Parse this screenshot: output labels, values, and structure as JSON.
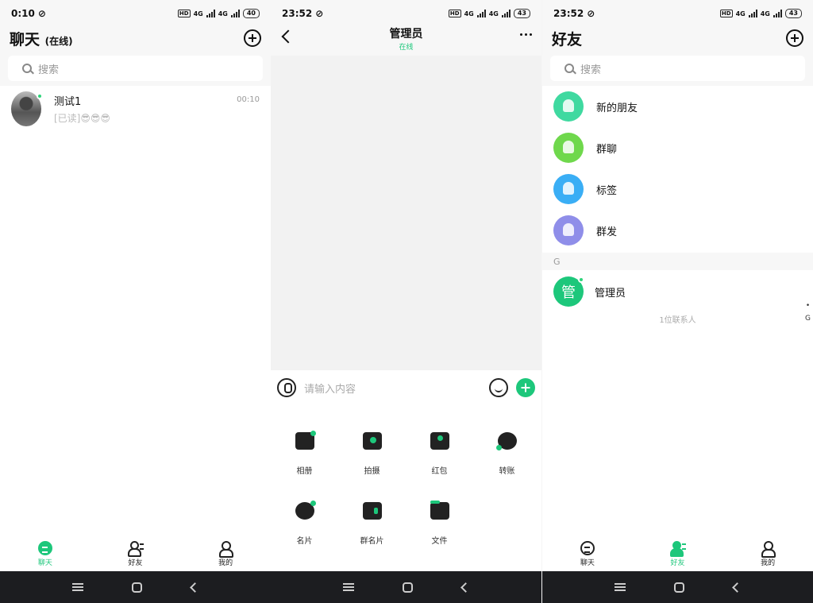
{
  "colors": {
    "accent": "#1dc77b",
    "online": "#2ed47a"
  },
  "panel1": {
    "status": {
      "time": "0:10",
      "battery": "40"
    },
    "title": "聊天",
    "title_suffix": "(在线)",
    "search_placeholder": "搜索",
    "chats": [
      {
        "name": "测试1",
        "preview": "[已读]😎😎😎",
        "time": "00:10"
      }
    ]
  },
  "panel2": {
    "status": {
      "time": "23:52",
      "battery": "43"
    },
    "title": "管理员",
    "subtitle": "在线",
    "input_placeholder": "请输入内容",
    "tools": [
      {
        "label": "相册",
        "icon": "image-icon"
      },
      {
        "label": "拍摄",
        "icon": "camera-icon"
      },
      {
        "label": "红包",
        "icon": "red-packet-icon"
      },
      {
        "label": "转账",
        "icon": "transfer-icon"
      },
      {
        "label": "名片",
        "icon": "contact-card-icon"
      },
      {
        "label": "群名片",
        "icon": "group-card-icon"
      },
      {
        "label": "文件",
        "icon": "folder-icon"
      }
    ]
  },
  "panel3": {
    "status": {
      "time": "23:52",
      "battery": "43"
    },
    "title": "好友",
    "search_placeholder": "搜索",
    "functions": [
      {
        "label": "新的朋友",
        "color": "#3fd9a0"
      },
      {
        "label": "群聊",
        "color": "#6fd84c"
      },
      {
        "label": "标签",
        "color": "#3aaef5"
      },
      {
        "label": "群发",
        "color": "#8f8ee9"
      }
    ],
    "section_letter": "G",
    "contact": {
      "name": "管理员",
      "avatar_char": "管"
    },
    "count_text": "1位联系人",
    "index_letters": [
      "•",
      "G"
    ]
  },
  "tabs": {
    "chat": "聊天",
    "friends": "好友",
    "me": "我的"
  },
  "status_network": "4G"
}
